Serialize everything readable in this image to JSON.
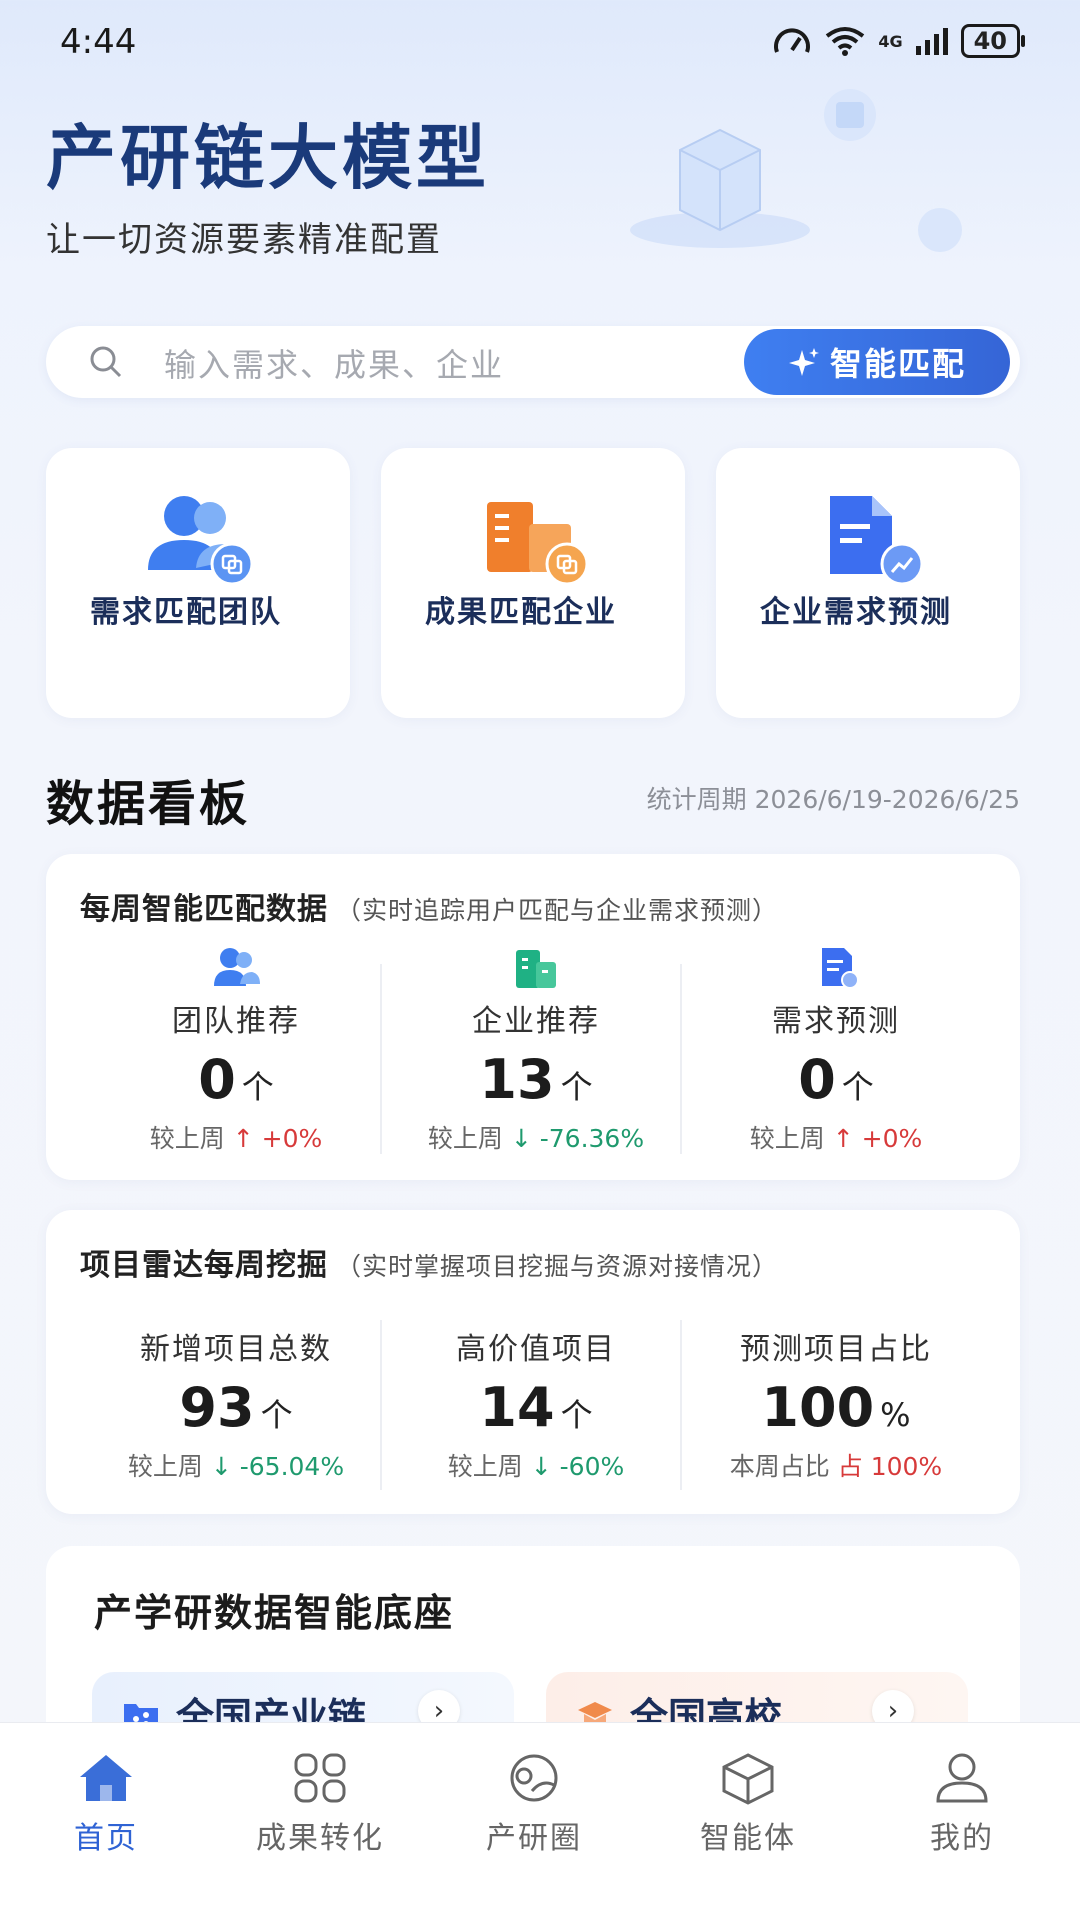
{
  "status_bar": {
    "time": "4:44",
    "battery": "40",
    "signal": "4G"
  },
  "hero": {
    "title": "产研链大模型",
    "subtitle": "让一切资源要素精准配置"
  },
  "search": {
    "placeholder": "输入需求、成果、企业",
    "button_label": "智能匹配"
  },
  "features": [
    {
      "label": "需求匹配团队",
      "icon": "team-match-icon"
    },
    {
      "label": "成果匹配企业",
      "icon": "enterprise-match-icon"
    },
    {
      "label": "企业需求预测",
      "icon": "demand-forecast-icon"
    }
  ],
  "dashboard": {
    "title": "数据看板",
    "period": "统计周期 2026/6/19-2026/6/25"
  },
  "weekly_panel": {
    "title": "每周智能匹配数据",
    "note": "（实时追踪用户匹配与企业需求预测）",
    "stats": [
      {
        "name": "团队推荐",
        "value": "0",
        "unit": "个",
        "compare_label": "较上周",
        "arrow": "↑",
        "change": "+0%",
        "trend": "up"
      },
      {
        "name": "企业推荐",
        "value": "13",
        "unit": "个",
        "compare_label": "较上周",
        "arrow": "↓",
        "change": "-76.36%",
        "trend": "down"
      },
      {
        "name": "需求预测",
        "value": "0",
        "unit": "个",
        "compare_label": "较上周",
        "arrow": "↑",
        "change": "+0%",
        "trend": "up"
      }
    ]
  },
  "radar_panel": {
    "title": "项目雷达每周挖掘",
    "note": "（实时掌握项目挖掘与资源对接情况）",
    "stats": [
      {
        "name": "新增项目总数",
        "value": "93",
        "unit": "个",
        "compare_label": "较上周",
        "arrow": "↓",
        "change": "-65.04%",
        "trend": "down"
      },
      {
        "name": "高价值项目",
        "value": "14",
        "unit": "个",
        "compare_label": "较上周",
        "arrow": "↓",
        "change": "-60%",
        "trend": "down"
      },
      {
        "name": "预测项目占比",
        "value": "100",
        "unit": "%",
        "compare_label": "本周占比",
        "arrow": "占",
        "change": "100%",
        "trend": "up"
      }
    ]
  },
  "base": {
    "title": "产学研数据智能底座",
    "cards": [
      {
        "label": "全国产业链",
        "icon": "industry-chain-icon"
      },
      {
        "label": "全国高校...",
        "icon": "university-icon"
      }
    ]
  },
  "nav": {
    "items": [
      {
        "label": "首页",
        "icon": "home-icon",
        "active": true
      },
      {
        "label": "成果转化",
        "icon": "grid-icon",
        "active": false
      },
      {
        "label": "产研圈",
        "icon": "circle-icon",
        "active": false
      },
      {
        "label": "智能体",
        "icon": "cube-icon",
        "active": false
      },
      {
        "label": "我的",
        "icon": "user-icon",
        "active": false
      }
    ]
  },
  "colors": {
    "accent": "#3565d6",
    "up": "#d73a3a",
    "down": "#1f9a6e",
    "title": "#1a3a7a"
  }
}
